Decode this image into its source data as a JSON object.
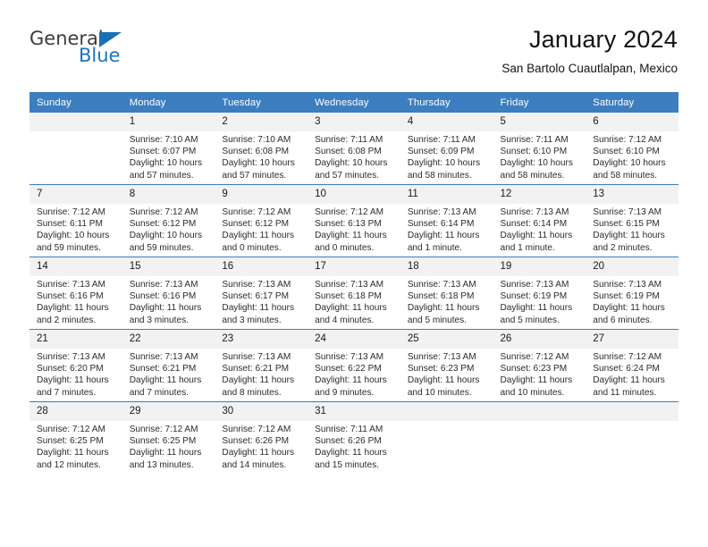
{
  "brand": {
    "name_part1": "General",
    "name_part2": "Blue"
  },
  "header": {
    "title": "January 2024",
    "subtitle": "San Bartolo Cuautlalpan, Mexico"
  },
  "colors": {
    "header_blue": "#3c7ebf",
    "brand_blue": "#1b75bb",
    "daynum_band": "#f2f2f2"
  },
  "weekdays": [
    "Sunday",
    "Monday",
    "Tuesday",
    "Wednesday",
    "Thursday",
    "Friday",
    "Saturday"
  ],
  "labels": {
    "sunrise_prefix": "Sunrise: ",
    "sunset_prefix": "Sunset: ",
    "daylight_prefix": "Daylight: "
  },
  "weeks": [
    [
      {
        "day": "",
        "empty": true
      },
      {
        "day": "1",
        "sunrise": "Sunrise: 7:10 AM",
        "sunset": "Sunset: 6:07 PM",
        "daylight_line1": "Daylight: 10 hours",
        "daylight_line2": "and 57 minutes."
      },
      {
        "day": "2",
        "sunrise": "Sunrise: 7:10 AM",
        "sunset": "Sunset: 6:08 PM",
        "daylight_line1": "Daylight: 10 hours",
        "daylight_line2": "and 57 minutes."
      },
      {
        "day": "3",
        "sunrise": "Sunrise: 7:11 AM",
        "sunset": "Sunset: 6:08 PM",
        "daylight_line1": "Daylight: 10 hours",
        "daylight_line2": "and 57 minutes."
      },
      {
        "day": "4",
        "sunrise": "Sunrise: 7:11 AM",
        "sunset": "Sunset: 6:09 PM",
        "daylight_line1": "Daylight: 10 hours",
        "daylight_line2": "and 58 minutes."
      },
      {
        "day": "5",
        "sunrise": "Sunrise: 7:11 AM",
        "sunset": "Sunset: 6:10 PM",
        "daylight_line1": "Daylight: 10 hours",
        "daylight_line2": "and 58 minutes."
      },
      {
        "day": "6",
        "sunrise": "Sunrise: 7:12 AM",
        "sunset": "Sunset: 6:10 PM",
        "daylight_line1": "Daylight: 10 hours",
        "daylight_line2": "and 58 minutes."
      }
    ],
    [
      {
        "day": "7",
        "sunrise": "Sunrise: 7:12 AM",
        "sunset": "Sunset: 6:11 PM",
        "daylight_line1": "Daylight: 10 hours",
        "daylight_line2": "and 59 minutes."
      },
      {
        "day": "8",
        "sunrise": "Sunrise: 7:12 AM",
        "sunset": "Sunset: 6:12 PM",
        "daylight_line1": "Daylight: 10 hours",
        "daylight_line2": "and 59 minutes."
      },
      {
        "day": "9",
        "sunrise": "Sunrise: 7:12 AM",
        "sunset": "Sunset: 6:12 PM",
        "daylight_line1": "Daylight: 11 hours",
        "daylight_line2": "and 0 minutes."
      },
      {
        "day": "10",
        "sunrise": "Sunrise: 7:12 AM",
        "sunset": "Sunset: 6:13 PM",
        "daylight_line1": "Daylight: 11 hours",
        "daylight_line2": "and 0 minutes."
      },
      {
        "day": "11",
        "sunrise": "Sunrise: 7:13 AM",
        "sunset": "Sunset: 6:14 PM",
        "daylight_line1": "Daylight: 11 hours",
        "daylight_line2": "and 1 minute."
      },
      {
        "day": "12",
        "sunrise": "Sunrise: 7:13 AM",
        "sunset": "Sunset: 6:14 PM",
        "daylight_line1": "Daylight: 11 hours",
        "daylight_line2": "and 1 minute."
      },
      {
        "day": "13",
        "sunrise": "Sunrise: 7:13 AM",
        "sunset": "Sunset: 6:15 PM",
        "daylight_line1": "Daylight: 11 hours",
        "daylight_line2": "and 2 minutes."
      }
    ],
    [
      {
        "day": "14",
        "sunrise": "Sunrise: 7:13 AM",
        "sunset": "Sunset: 6:16 PM",
        "daylight_line1": "Daylight: 11 hours",
        "daylight_line2": "and 2 minutes."
      },
      {
        "day": "15",
        "sunrise": "Sunrise: 7:13 AM",
        "sunset": "Sunset: 6:16 PM",
        "daylight_line1": "Daylight: 11 hours",
        "daylight_line2": "and 3 minutes."
      },
      {
        "day": "16",
        "sunrise": "Sunrise: 7:13 AM",
        "sunset": "Sunset: 6:17 PM",
        "daylight_line1": "Daylight: 11 hours",
        "daylight_line2": "and 3 minutes."
      },
      {
        "day": "17",
        "sunrise": "Sunrise: 7:13 AM",
        "sunset": "Sunset: 6:18 PM",
        "daylight_line1": "Daylight: 11 hours",
        "daylight_line2": "and 4 minutes."
      },
      {
        "day": "18",
        "sunrise": "Sunrise: 7:13 AM",
        "sunset": "Sunset: 6:18 PM",
        "daylight_line1": "Daylight: 11 hours",
        "daylight_line2": "and 5 minutes."
      },
      {
        "day": "19",
        "sunrise": "Sunrise: 7:13 AM",
        "sunset": "Sunset: 6:19 PM",
        "daylight_line1": "Daylight: 11 hours",
        "daylight_line2": "and 5 minutes."
      },
      {
        "day": "20",
        "sunrise": "Sunrise: 7:13 AM",
        "sunset": "Sunset: 6:19 PM",
        "daylight_line1": "Daylight: 11 hours",
        "daylight_line2": "and 6 minutes."
      }
    ],
    [
      {
        "day": "21",
        "sunrise": "Sunrise: 7:13 AM",
        "sunset": "Sunset: 6:20 PM",
        "daylight_line1": "Daylight: 11 hours",
        "daylight_line2": "and 7 minutes."
      },
      {
        "day": "22",
        "sunrise": "Sunrise: 7:13 AM",
        "sunset": "Sunset: 6:21 PM",
        "daylight_line1": "Daylight: 11 hours",
        "daylight_line2": "and 7 minutes."
      },
      {
        "day": "23",
        "sunrise": "Sunrise: 7:13 AM",
        "sunset": "Sunset: 6:21 PM",
        "daylight_line1": "Daylight: 11 hours",
        "daylight_line2": "and 8 minutes."
      },
      {
        "day": "24",
        "sunrise": "Sunrise: 7:13 AM",
        "sunset": "Sunset: 6:22 PM",
        "daylight_line1": "Daylight: 11 hours",
        "daylight_line2": "and 9 minutes."
      },
      {
        "day": "25",
        "sunrise": "Sunrise: 7:13 AM",
        "sunset": "Sunset: 6:23 PM",
        "daylight_line1": "Daylight: 11 hours",
        "daylight_line2": "and 10 minutes."
      },
      {
        "day": "26",
        "sunrise": "Sunrise: 7:12 AM",
        "sunset": "Sunset: 6:23 PM",
        "daylight_line1": "Daylight: 11 hours",
        "daylight_line2": "and 10 minutes."
      },
      {
        "day": "27",
        "sunrise": "Sunrise: 7:12 AM",
        "sunset": "Sunset: 6:24 PM",
        "daylight_line1": "Daylight: 11 hours",
        "daylight_line2": "and 11 minutes."
      }
    ],
    [
      {
        "day": "28",
        "sunrise": "Sunrise: 7:12 AM",
        "sunset": "Sunset: 6:25 PM",
        "daylight_line1": "Daylight: 11 hours",
        "daylight_line2": "and 12 minutes."
      },
      {
        "day": "29",
        "sunrise": "Sunrise: 7:12 AM",
        "sunset": "Sunset: 6:25 PM",
        "daylight_line1": "Daylight: 11 hours",
        "daylight_line2": "and 13 minutes."
      },
      {
        "day": "30",
        "sunrise": "Sunrise: 7:12 AM",
        "sunset": "Sunset: 6:26 PM",
        "daylight_line1": "Daylight: 11 hours",
        "daylight_line2": "and 14 minutes."
      },
      {
        "day": "31",
        "sunrise": "Sunrise: 7:11 AM",
        "sunset": "Sunset: 6:26 PM",
        "daylight_line1": "Daylight: 11 hours",
        "daylight_line2": "and 15 minutes."
      },
      {
        "day": "",
        "empty": true
      },
      {
        "day": "",
        "empty": true
      },
      {
        "day": "",
        "empty": true
      }
    ]
  ]
}
